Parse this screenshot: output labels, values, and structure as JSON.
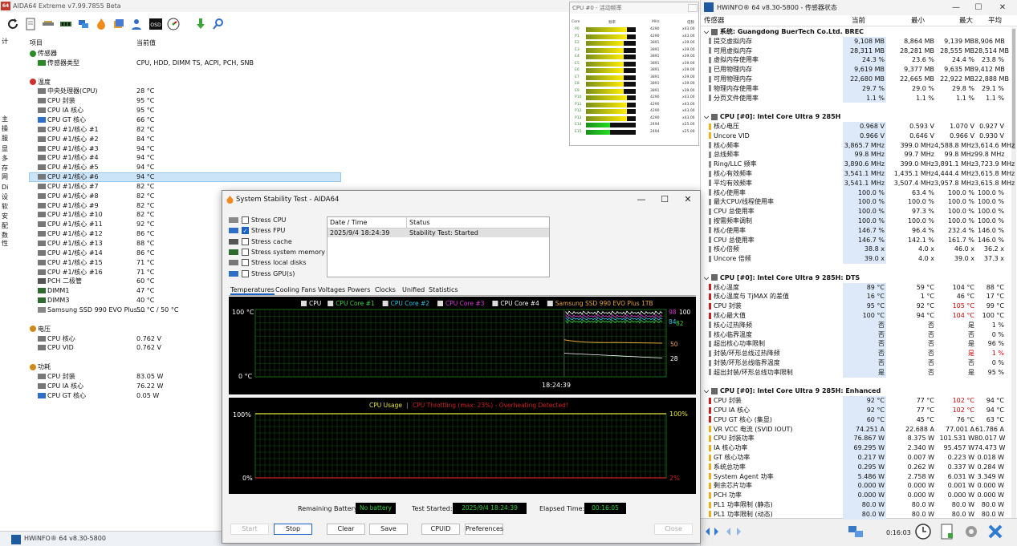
{
  "aida": {
    "title": "AIDA64 Extreme v7.99.7855 Beta",
    "logo": "64",
    "col_item": "项目",
    "col_value": "当前值",
    "nav_items": [
      "计",
      "主",
      "操",
      "服",
      "显",
      "多",
      "存",
      "网",
      "Di",
      "设",
      "软",
      "安",
      "配",
      "数",
      "性"
    ],
    "rows": [
      {
        "label": "传感器",
        "value": "",
        "indent": 0,
        "icon": "sensor-icon"
      },
      {
        "label": "传感器类型",
        "value": "CPU, HDD, DIMM TS, ACPI, PCH, SNB",
        "indent": 1,
        "icon": "sensor-icon"
      },
      {
        "label": "",
        "value": "",
        "indent": 0,
        "icon": ""
      },
      {
        "label": "温度",
        "value": "",
        "indent": 0,
        "icon": "thermometer-icon"
      },
      {
        "label": "中央处理器(CPU)",
        "value": "28 °C",
        "indent": 1,
        "icon": "chip-icon"
      },
      {
        "label": "CPU 封装",
        "value": "95 °C",
        "indent": 1,
        "icon": "chip-icon"
      },
      {
        "label": "CPU IA 核心",
        "value": "95 °C",
        "indent": 1,
        "icon": "chip-icon"
      },
      {
        "label": "CPU GT 核心",
        "value": "66 °C",
        "indent": 1,
        "icon": "gpu-icon"
      },
      {
        "label": "CPU #1/核心 #1",
        "value": "82 °C",
        "indent": 1,
        "icon": "chip-icon"
      },
      {
        "label": "CPU #1/核心 #2",
        "value": "84 °C",
        "indent": 1,
        "icon": "chip-icon"
      },
      {
        "label": "CPU #1/核心 #3",
        "value": "94 °C",
        "indent": 1,
        "icon": "chip-icon"
      },
      {
        "label": "CPU #1/核心 #4",
        "value": "94 °C",
        "indent": 1,
        "icon": "chip-icon"
      },
      {
        "label": "CPU #1/核心 #5",
        "value": "94 °C",
        "indent": 1,
        "icon": "chip-icon"
      },
      {
        "label": "CPU #1/核心 #6",
        "value": "94 °C",
        "indent": 1,
        "icon": "chip-icon"
      },
      {
        "label": "CPU #1/核心 #7",
        "value": "82 °C",
        "indent": 1,
        "icon": "chip-icon"
      },
      {
        "label": "CPU #1/核心 #8",
        "value": "82 °C",
        "indent": 1,
        "icon": "chip-icon"
      },
      {
        "label": "CPU #1/核心 #9",
        "value": "82 °C",
        "indent": 1,
        "icon": "chip-icon"
      },
      {
        "label": "CPU #1/核心 #10",
        "value": "82 °C",
        "indent": 1,
        "icon": "chip-icon"
      },
      {
        "label": "CPU #1/核心 #11",
        "value": "92 °C",
        "indent": 1,
        "icon": "chip-icon"
      },
      {
        "label": "CPU #1/核心 #12",
        "value": "86 °C",
        "indent": 1,
        "icon": "chip-icon"
      },
      {
        "label": "CPU #1/核心 #13",
        "value": "88 °C",
        "indent": 1,
        "icon": "chip-icon"
      },
      {
        "label": "CPU #1/核心 #14",
        "value": "86 °C",
        "indent": 1,
        "icon": "chip-icon"
      },
      {
        "label": "CPU #1/核心 #15",
        "value": "71 °C",
        "indent": 1,
        "icon": "chip-icon"
      },
      {
        "label": "CPU #1/核心 #16",
        "value": "71 °C",
        "indent": 1,
        "icon": "chip-icon"
      },
      {
        "label": "PCH 二极管",
        "value": "60 °C",
        "indent": 1,
        "icon": "pch-icon"
      },
      {
        "label": "DIMM1",
        "value": "47 °C",
        "indent": 1,
        "icon": "memory-icon"
      },
      {
        "label": "DIMM3",
        "value": "40 °C",
        "indent": 1,
        "icon": "memory-icon"
      },
      {
        "label": "Samsung SSD 990 EVO Plus ...",
        "value": "50 °C / 50 °C",
        "indent": 1,
        "icon": "disk-icon"
      },
      {
        "label": "",
        "value": "",
        "indent": 0,
        "icon": ""
      },
      {
        "label": "电压",
        "value": "",
        "indent": 0,
        "icon": "voltage-icon"
      },
      {
        "label": "CPU 核心",
        "value": "0.762 V",
        "indent": 1,
        "icon": "chip-icon"
      },
      {
        "label": "CPU VID",
        "value": "0.762 V",
        "indent": 1,
        "icon": "chip-icon"
      },
      {
        "label": "",
        "value": "",
        "indent": 0,
        "icon": ""
      },
      {
        "label": "功耗",
        "value": "",
        "indent": 0,
        "icon": "power-icon"
      },
      {
        "label": "CPU 封装",
        "value": "83.05 W",
        "indent": 1,
        "icon": "chip-icon"
      },
      {
        "label": "CPU IA 核心",
        "value": "76.22 W",
        "indent": 1,
        "icon": "chip-icon"
      },
      {
        "label": "CPU GT 核心",
        "value": "0.05 W",
        "indent": 1,
        "icon": "gpu-icon"
      }
    ]
  },
  "activity": {
    "title": "CPU #0 - 活动频率",
    "headers": [
      "Core",
      "频率",
      "MHz",
      "倍频"
    ],
    "cores": [
      {
        "label": "P0",
        "frac": 0.83,
        "mhz": "4290",
        "mul": "x43.00"
      },
      {
        "label": "P1",
        "frac": 0.83,
        "mhz": "4290",
        "mul": "x43.00"
      },
      {
        "label": "E2",
        "frac": 0.75,
        "mhz": "3891",
        "mul": "x39.00"
      },
      {
        "label": "E3",
        "frac": 0.75,
        "mhz": "3891",
        "mul": "x39.00"
      },
      {
        "label": "E4",
        "frac": 0.75,
        "mhz": "3891",
        "mul": "x39.00"
      },
      {
        "label": "E5",
        "frac": 0.75,
        "mhz": "3891",
        "mul": "x39.00"
      },
      {
        "label": "E6",
        "frac": 0.75,
        "mhz": "3891",
        "mul": "x39.00"
      },
      {
        "label": "E7",
        "frac": 0.75,
        "mhz": "3891",
        "mul": "x39.00"
      },
      {
        "label": "E8",
        "frac": 0.75,
        "mhz": "3891",
        "mul": "x39.00"
      },
      {
        "label": "E9",
        "frac": 0.75,
        "mhz": "3891",
        "mul": "x39.00"
      },
      {
        "label": "P10",
        "frac": 0.83,
        "mhz": "4290",
        "mul": "x43.00"
      },
      {
        "label": "P11",
        "frac": 0.83,
        "mhz": "4290",
        "mul": "x43.00"
      },
      {
        "label": "P12",
        "frac": 0.83,
        "mhz": "4290",
        "mul": "x43.00"
      },
      {
        "label": "P13",
        "frac": 0.83,
        "mhz": "4290",
        "mul": "x43.00"
      },
      {
        "label": "E14",
        "frac": 0.48,
        "mhz": "2494",
        "mul": "x25.00"
      },
      {
        "label": "E15",
        "frac": 0.48,
        "mhz": "2494",
        "mul": "x25.00"
      }
    ]
  },
  "hwinfo": {
    "title": "HWiNFO® 64 v8.30-5800 - 传感器状态",
    "cols": [
      "传感器",
      "当前",
      "最小",
      "最大",
      "平均"
    ],
    "rows": [
      {
        "name": "系统: Guangdong BuerTech Co.Ltd. BREC",
        "grp": true
      },
      {
        "name": "提交虚拟内存",
        "v": [
          "9,108 MB",
          "8,864 MB",
          "9,139 MB",
          "8,906 MB"
        ]
      },
      {
        "name": "可用虚拟内存",
        "v": [
          "28,311 MB",
          "28,281 MB",
          "28,555 MB",
          "28,514 MB"
        ]
      },
      {
        "name": "虚拟内存使用率",
        "v": [
          "24.3 %",
          "23.6 %",
          "24.4 %",
          "23.8 %"
        ]
      },
      {
        "name": "已用物理内存",
        "v": [
          "9,619 MB",
          "9,377 MB",
          "9,635 MB",
          "9,412 MB"
        ]
      },
      {
        "name": "可用物理内存",
        "v": [
          "22,680 MB",
          "22,665 MB",
          "22,922 MB",
          "22,888 MB"
        ]
      },
      {
        "name": "物理内存使用率",
        "v": [
          "29.7 %",
          "29.0 %",
          "29.8 %",
          "29.1 %"
        ]
      },
      {
        "name": "分页文件使用率",
        "v": [
          "1.1 %",
          "1.1 %",
          "1.1 %",
          "1.1 %"
        ]
      },
      {
        "name": "",
        "blank": true
      },
      {
        "name": "CPU [#0]: Intel Core Ultra 9 285H",
        "grp": true
      },
      {
        "name": "核心电压",
        "v": [
          "0.968 V",
          "0.593 V",
          "1.070 V",
          "0.927 V"
        ]
      },
      {
        "name": "Uncore VID",
        "v": [
          "0.966 V",
          "0.646 V",
          "0.966 V",
          "0.930 V"
        ]
      },
      {
        "name": "核心频率",
        "v": [
          "3,865.7 MHz",
          "399.0 MHz",
          "4,588.8 MHz",
          "3,614.6 MHz"
        ]
      },
      {
        "name": "总线频率",
        "v": [
          "99.8 MHz",
          "99.7 MHz",
          "99.8 MHz",
          "99.8 MHz"
        ]
      },
      {
        "name": "Ring/LLC 频率",
        "v": [
          "3,890.6 MHz",
          "399.0 MHz",
          "3,891.1 MHz",
          "3,723.9 MHz"
        ]
      },
      {
        "name": "核心有效频率",
        "v": [
          "3,541.1 MHz",
          "1,435.1 MHz",
          "4,444.4 MHz",
          "3,615.8 MHz"
        ]
      },
      {
        "name": "平均有效频率",
        "v": [
          "3,541.1 MHz",
          "3,507.4 MHz",
          "3,957.8 MHz",
          "3,615.8 MHz"
        ]
      },
      {
        "name": "核心使用率",
        "v": [
          "100.0 %",
          "63.4 %",
          "100.0 %",
          "100.0 %"
        ]
      },
      {
        "name": "最大CPU/线程使用率",
        "v": [
          "100.0 %",
          "100.0 %",
          "100.0 %",
          "100.0 %"
        ]
      },
      {
        "name": "CPU 总使用率",
        "v": [
          "100.0 %",
          "97.3 %",
          "100.0 %",
          "100.0 %"
        ]
      },
      {
        "name": "按需频率调制",
        "v": [
          "100.0 %",
          "100.0 %",
          "100.0 %",
          "100.0 %"
        ]
      },
      {
        "name": "核心使用率",
        "v": [
          "146.7 %",
          "96.4 %",
          "232.4 %",
          "146.0 %"
        ]
      },
      {
        "name": "CPU 总使用率",
        "v": [
          "146.7 %",
          "142.1 %",
          "161.7 %",
          "146.0 %"
        ]
      },
      {
        "name": "核心倍频",
        "v": [
          "38.8 x",
          "4.0 x",
          "46.0 x",
          "36.2 x"
        ]
      },
      {
        "name": "Uncore 倍频",
        "v": [
          "39.0 x",
          "4.0 x",
          "39.0 x",
          "37.3 x"
        ]
      },
      {
        "name": "",
        "blank": true
      },
      {
        "name": "CPU [#0]: Intel Core Ultra 9 285H: DTS",
        "grp": true
      },
      {
        "name": "核心温度",
        "v": [
          "89 °C",
          "59 °C",
          "104 °C",
          "88 °C"
        ]
      },
      {
        "name": "核心温度与 TjMAX 的差值",
        "v": [
          "16 °C",
          "1 °C",
          "46 °C",
          "17 °C"
        ]
      },
      {
        "name": "CPU 封装",
        "v": [
          "95 °C",
          "92 °C",
          "105 °C",
          "99 °C"
        ],
        "red": [
          2
        ]
      },
      {
        "name": "核心最大值",
        "v": [
          "100 °C",
          "94 °C",
          "104 °C",
          "100 °C"
        ],
        "red": [
          2
        ]
      },
      {
        "name": "核心过热降频",
        "v": [
          "否",
          "否",
          "是",
          "1 %"
        ]
      },
      {
        "name": "核心临界温度",
        "v": [
          "否",
          "否",
          "否",
          "0 %"
        ]
      },
      {
        "name": "超出核心功率限制",
        "v": [
          "否",
          "否",
          "是",
          "96 %"
        ]
      },
      {
        "name": "封装/环形总线过热降频",
        "v": [
          "否",
          "否",
          "是",
          "1 %"
        ],
        "red": [
          2,
          3
        ]
      },
      {
        "name": "封装/环形总线临界温度",
        "v": [
          "否",
          "否",
          "否",
          "0 %"
        ]
      },
      {
        "name": "超出封装/环形总线功率限制",
        "v": [
          "是",
          "否",
          "是",
          "95 %"
        ]
      },
      {
        "name": "",
        "blank": true
      },
      {
        "name": "CPU [#0]: Intel Core Ultra 9 285H: Enhanced",
        "grp": true
      },
      {
        "name": "CPU 封装",
        "v": [
          "92 °C",
          "77 °C",
          "102 °C",
          "94 °C"
        ],
        "red": [
          2
        ]
      },
      {
        "name": "CPU IA 核心",
        "v": [
          "92 °C",
          "77 °C",
          "102 °C",
          "94 °C"
        ],
        "red": [
          2
        ]
      },
      {
        "name": "CPU GT 核心 (集显)",
        "v": [
          "60 °C",
          "45 °C",
          "76 °C",
          "63 °C"
        ]
      },
      {
        "name": "VR VCC 电流 (SVID IOUT)",
        "v": [
          "74.251 A",
          "22.688 A",
          "77.001 A",
          "61.786 A"
        ]
      },
      {
        "name": "CPU 封装功率",
        "v": [
          "76.867 W",
          "8.375 W",
          "101.531 W",
          "80.017 W"
        ]
      },
      {
        "name": "IA 核心功率",
        "v": [
          "69.295 W",
          "2.340 W",
          "95.457 W",
          "74.473 W"
        ]
      },
      {
        "name": "GT 核心功率",
        "v": [
          "0.217 W",
          "0.007 W",
          "0.223 W",
          "0.018 W"
        ]
      },
      {
        "name": "系统总功率",
        "v": [
          "0.295 W",
          "0.262 W",
          "0.337 W",
          "0.284 W"
        ]
      },
      {
        "name": "System Agent 功率",
        "v": [
          "5.486 W",
          "2.758 W",
          "6.031 W",
          "3.349 W"
        ]
      },
      {
        "name": "剩余芯片功率",
        "v": [
          "0.000 W",
          "0.000 W",
          "0.001 W",
          "0.000 W"
        ]
      },
      {
        "name": "PCH 功率",
        "v": [
          "0.000 W",
          "0.000 W",
          "0.000 W",
          "0.000 W"
        ]
      },
      {
        "name": "PL1 功率限制 (静态)",
        "v": [
          "80.0 W",
          "80.0 W",
          "80.0 W",
          "80.0 W"
        ]
      },
      {
        "name": "PL1 功率限制 (动态)",
        "v": [
          "80.0 W",
          "80.0 W",
          "80.0 W",
          "80.0 W"
        ]
      }
    ],
    "elapsed": "0:16:03"
  },
  "taskbar": {
    "label": "HWiNFO® 64 v8.30-5800"
  },
  "stability": {
    "title": "System Stability Test - AIDA64",
    "checks": [
      {
        "label": "Stress CPU",
        "on": false
      },
      {
        "label": "Stress FPU",
        "on": true
      },
      {
        "label": "Stress cache",
        "on": false
      },
      {
        "label": "Stress system memory",
        "on": false
      },
      {
        "label": "Stress local disks",
        "on": false
      },
      {
        "label": "Stress GPU(s)",
        "on": false
      }
    ],
    "log_headers": [
      "Date / Time",
      "Status"
    ],
    "log_row": [
      "2025/9/4 18:24:39",
      "Stability Test: Started"
    ],
    "tabs": [
      "Temperatures",
      "Cooling Fans",
      "Voltages",
      "Powers",
      "Clocks",
      "Unified",
      "Statistics"
    ],
    "temp_legend": [
      {
        "label": "CPU",
        "color": "#ffffff"
      },
      {
        "label": "CPU Core #1",
        "color": "#3ad63a"
      },
      {
        "label": "CPU Core #2",
        "color": "#2ec7e8"
      },
      {
        "label": "CPU Core #3",
        "color": "#d63ad6"
      },
      {
        "label": "CPU Core #4",
        "color": "#ffffff"
      },
      {
        "label": "Samsung SSD 990 EVO Plus 1TB",
        "color": "#e8a43a"
      }
    ],
    "temp_axis": {
      "top": "100 °C",
      "bottom": "0 °C",
      "time": "18:24:39"
    },
    "temp_right": [
      {
        "text": "98",
        "color": "#d63ad6"
      },
      {
        "text": "100",
        "color": "#ffffff"
      },
      {
        "text": "84",
        "color": "#2ec7e8"
      },
      {
        "text": "82",
        "color": "#3ad63a"
      },
      {
        "text": "50",
        "color": "#e8a43a"
      },
      {
        "text": "28",
        "color": "#ffffff"
      }
    ],
    "usage_title": "CPU Usage",
    "throttle_text": "CPU Throttling (max: 23%) - Overheating Detected!",
    "usage_axis": {
      "top": "100%",
      "bottom": "0%",
      "right_top": "100%",
      "right_bottom": "2%"
    },
    "status": {
      "battery_label": "Remaining Battery:",
      "battery": "No battery",
      "started_label": "Test Started:",
      "started": "2025/9/4 18:24:39",
      "elapsed_label": "Elapsed Time:",
      "elapsed": "00:16:05"
    },
    "buttons": [
      "Start",
      "Stop",
      "Clear",
      "Save",
      "CPUID",
      "Preferences",
      "Close"
    ]
  }
}
